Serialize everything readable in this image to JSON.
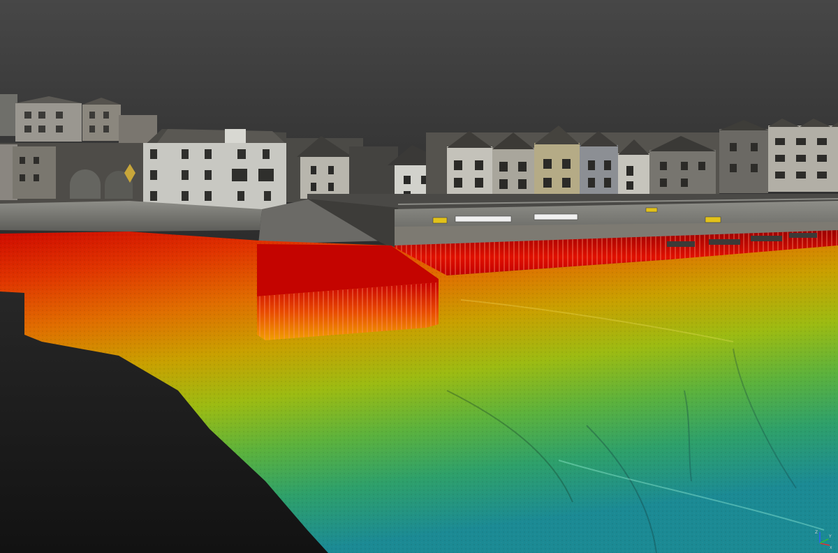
{
  "viewer": {
    "background_top": "#474747",
    "background_bottom": "#121212",
    "colormap": [
      "#d00000",
      "#e33c00",
      "#e07a00",
      "#c9a800",
      "#9fbf10",
      "#5fb840",
      "#2fa870",
      "#1c8f98"
    ]
  },
  "signs": [
    {
      "text": "",
      "colour": "#e2c21a"
    },
    {
      "text": "",
      "colour": "#f0f0f0"
    },
    {
      "text": "",
      "colour": "#f0f0f0"
    },
    {
      "text": "",
      "colour": "#e2c21a"
    },
    {
      "text": "",
      "colour": "#e2c21a"
    }
  ],
  "axis_gizmo": {
    "z_label": "Z",
    "y_label": "Y",
    "x_label": "X",
    "x_colour": "#e23030",
    "y_colour": "#30c030",
    "z_colour": "#3060ff"
  }
}
